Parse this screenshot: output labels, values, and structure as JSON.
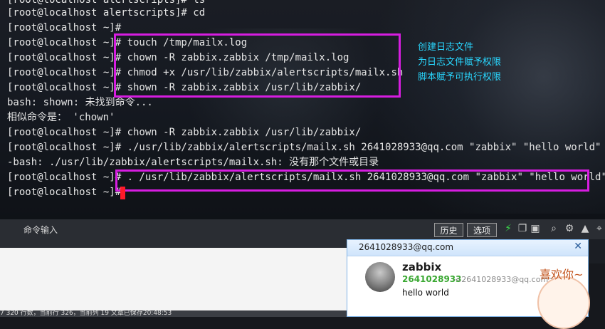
{
  "terminal": {
    "lines": [
      "[root@localhost alertscripts]# ls",
      "[root@localhost alertscripts]# cd",
      "[root@localhost ~]#",
      "[root@localhost ~]# touch /tmp/mailx.log",
      "[root@localhost ~]# chown -R zabbix.zabbix /tmp/mailx.log",
      "[root@localhost ~]# chmod +x /usr/lib/zabbix/alertscripts/mailx.sh",
      "[root@localhost ~]# shown -R zabbix.zabbix /usr/lib/zabbix/",
      "bash: shown: 未找到命令...",
      "相似命令是： 'chown'",
      "[root@localhost ~]# chown -R zabbix.zabbix /usr/lib/zabbix/",
      "[root@localhost ~]# ./usr/lib/zabbix/alertscripts/mailx.sh 2641028933@qq.com \"zabbix\" \"hello world\"",
      "-bash: ./usr/lib/zabbix/alertscripts/mailx.sh: 没有那个文件或目录",
      "[root@localhost ~]# . /usr/lib/zabbix/alertscripts/mailx.sh 2641028933@qq.com \"zabbix\" \"hello world\"",
      "[root@localhost ~]#"
    ],
    "annotations": [
      "创建日志文件",
      "为日志文件赋予权限",
      "脚本赋予可执行权限"
    ],
    "highlight_color": "#d61de0",
    "annotation_color": "#29d7ff"
  },
  "toolbar": {
    "command_input_label": "命令输入",
    "history_label": "历史",
    "options_label": "选项"
  },
  "status_bar": {
    "text": "7  320 行数，当前行 326，当前列 19  文章已保存20:48:53"
  },
  "notification": {
    "header_email": "2641028933@qq.com",
    "sender_name": "zabbix",
    "sender_number": "2641028933",
    "sender_full": "<2641028933@qq.com>",
    "body": "hello world",
    "close_icon": "close-icon"
  },
  "sticker": {
    "text": "喜欢你~"
  }
}
